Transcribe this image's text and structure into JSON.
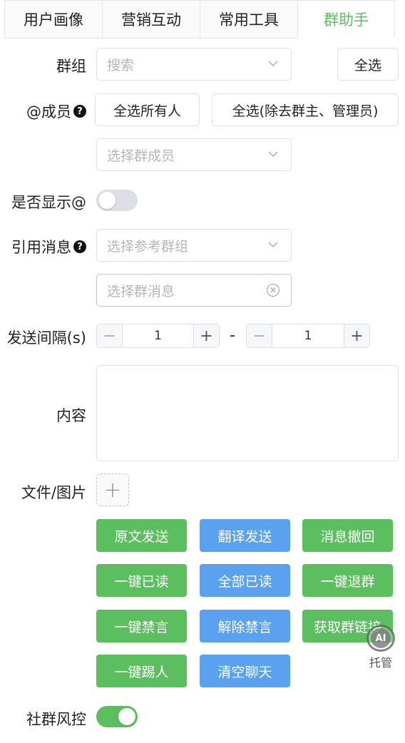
{
  "tabs": [
    {
      "label": "用户画像"
    },
    {
      "label": "营销互动"
    },
    {
      "label": "常用工具"
    },
    {
      "label": "群助手"
    }
  ],
  "group": {
    "label": "群组",
    "placeholder": "搜索",
    "select_all": "全选"
  },
  "mention": {
    "label": "@成员",
    "select_everyone": "全选所有人",
    "select_except_admin": "全选(除去群主、管理员)",
    "member_placeholder": "选择群成员"
  },
  "show_at": {
    "label": "是否显示@",
    "on": false
  },
  "quote": {
    "label": "引用消息",
    "group_placeholder": "选择参考群组",
    "message_placeholder": "选择群消息"
  },
  "interval": {
    "label": "发送间隔(s)",
    "min": "1",
    "max": "1",
    "separator": "-"
  },
  "content": {
    "label": "内容"
  },
  "file": {
    "label": "文件/图片"
  },
  "actions": [
    {
      "label": "原文发送",
      "color": "#5cbf5f"
    },
    {
      "label": "翻译发送",
      "color": "#5aa1ef"
    },
    {
      "label": "消息撤回",
      "color": "#5cbf5f"
    },
    {
      "label": "一键已读",
      "color": "#5cbf5f"
    },
    {
      "label": "全部已读",
      "color": "#5aa1ef"
    },
    {
      "label": "一键退群",
      "color": "#5cbf5f"
    },
    {
      "label": "一键禁言",
      "color": "#5cbf5f"
    },
    {
      "label": "解除禁言",
      "color": "#5aa1ef"
    },
    {
      "label": "获取群链接",
      "color": "#5cbf5f"
    },
    {
      "label": "一键踢人",
      "color": "#5cbf5f"
    },
    {
      "label": "清空聊天",
      "color": "#5aa1ef"
    }
  ],
  "risk": {
    "label": "社群风控",
    "on": true
  },
  "ai": {
    "icon_text": "AI",
    "label": "托管"
  },
  "icons": {
    "help": "question-circle-icon",
    "chevron": "chevron-down-icon",
    "clear": "clear-circle-icon",
    "upload": "plus-icon"
  },
  "colors": {
    "accent_green": "#5cbf5f",
    "accent_blue": "#5aa1ef"
  }
}
